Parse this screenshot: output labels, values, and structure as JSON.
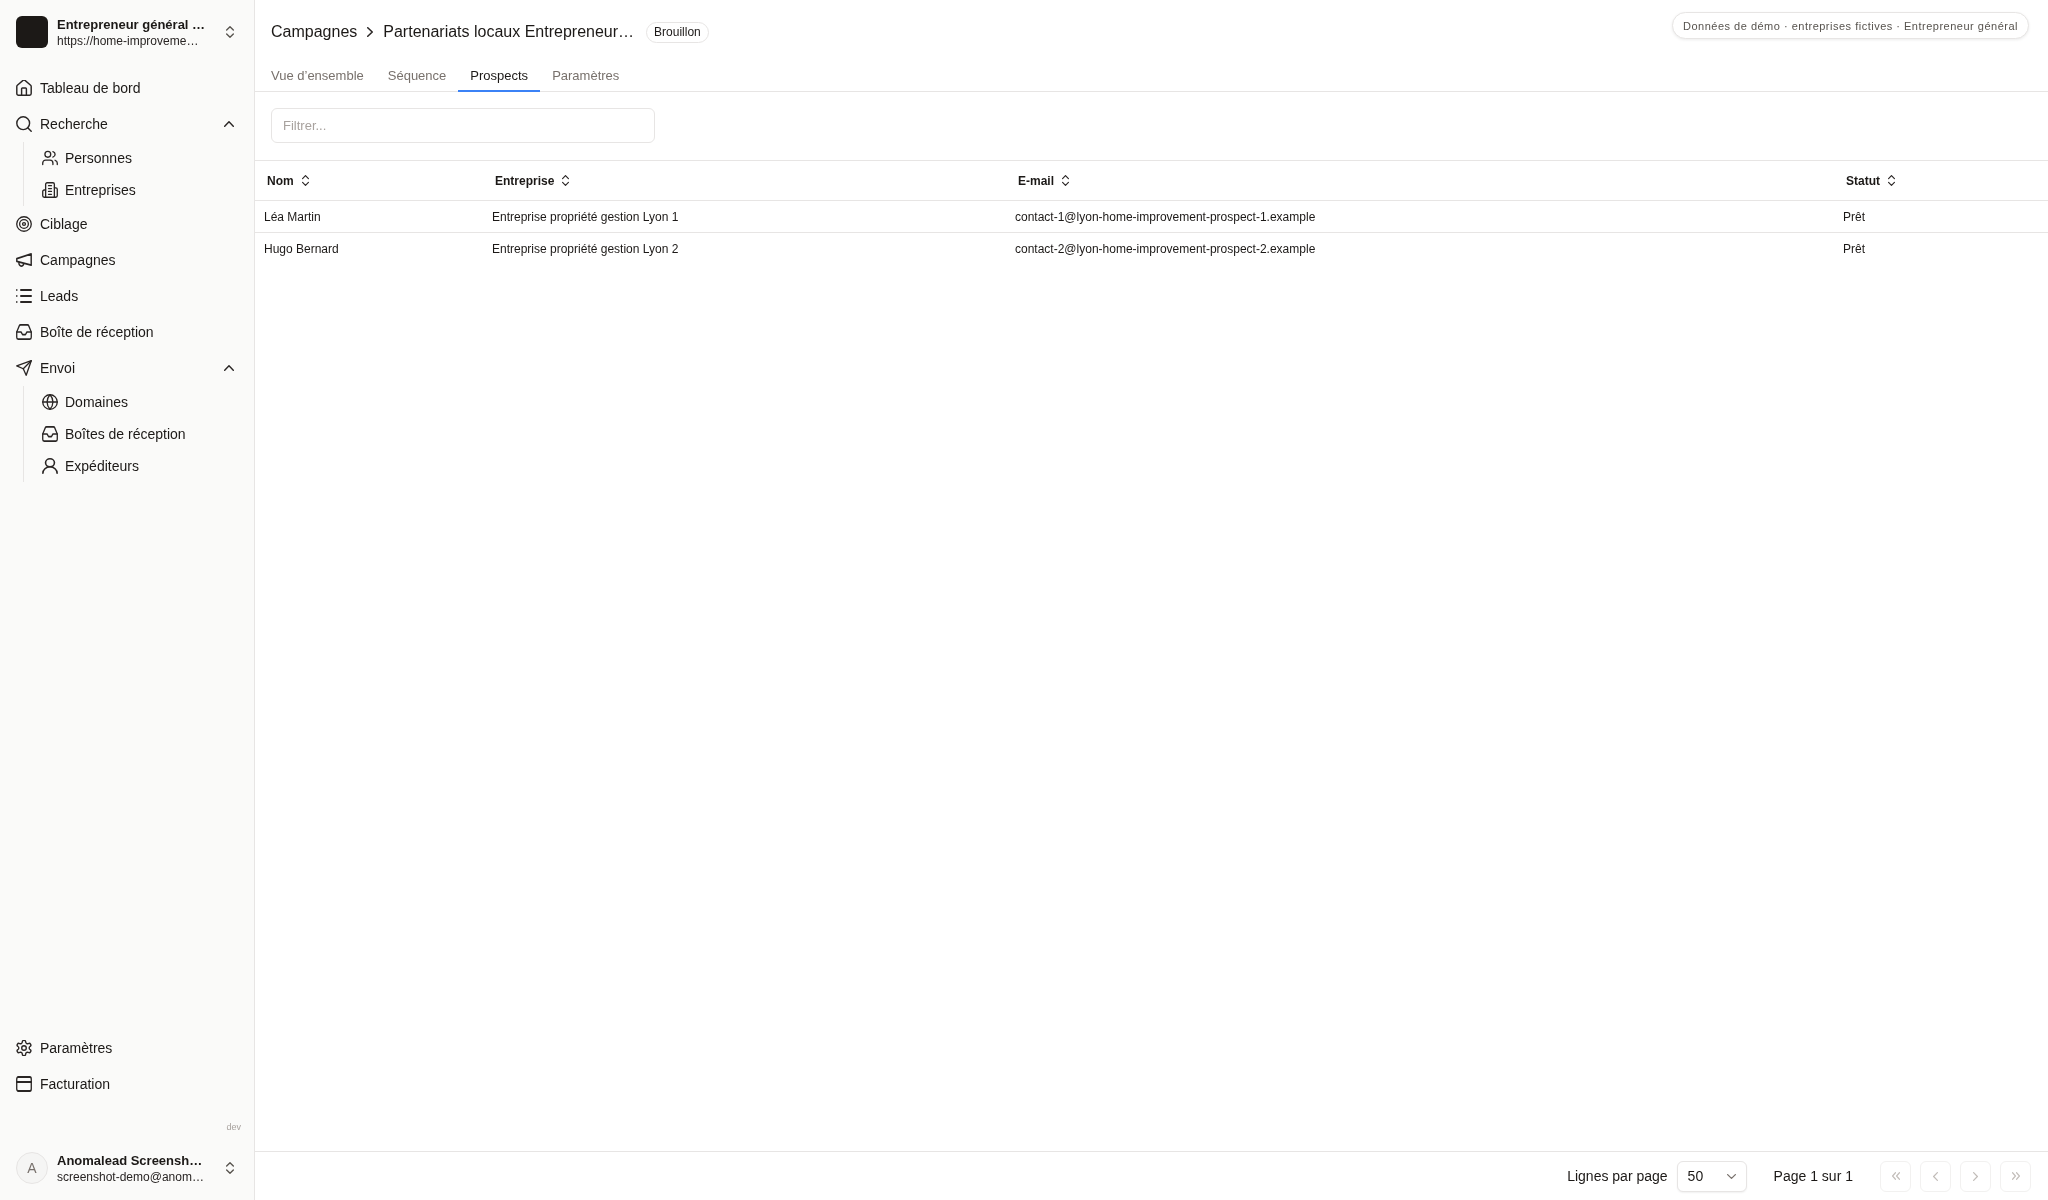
{
  "sidebar": {
    "workspace": {
      "name": "Entrepreneur général …",
      "url": "https://home-improveme…"
    },
    "nav": [
      {
        "label": "Tableau de bord"
      },
      {
        "label": "Recherche",
        "expanded": true,
        "children": [
          {
            "label": "Personnes"
          },
          {
            "label": "Entreprises"
          }
        ]
      },
      {
        "label": "Ciblage"
      },
      {
        "label": "Campagnes"
      },
      {
        "label": "Leads"
      },
      {
        "label": "Boîte de réception"
      },
      {
        "label": "Envoi",
        "expanded": true,
        "children": [
          {
            "label": "Domaines"
          },
          {
            "label": "Boîtes de réception"
          },
          {
            "label": "Expéditeurs"
          }
        ]
      }
    ],
    "footer_nav": [
      {
        "label": "Paramètres"
      },
      {
        "label": "Facturation"
      }
    ],
    "environment": "dev",
    "user": {
      "initial": "A",
      "name": "Anomalead Screensh…",
      "email": "screenshot-demo@anom…"
    }
  },
  "header": {
    "breadcrumb": [
      "Campagnes",
      "Partenariats locaux Entrepreneur…"
    ],
    "status_badge": "Brouillon",
    "demo_notice": "Données de démo · entreprises fictives · Entrepreneur général"
  },
  "tabs": [
    {
      "label": "Vue d’ensemble",
      "selected": false
    },
    {
      "label": "Séquence",
      "selected": false
    },
    {
      "label": "Prospects",
      "selected": true
    },
    {
      "label": "Paramètres",
      "selected": false
    }
  ],
  "filter": {
    "placeholder": "Filtrer..."
  },
  "table": {
    "columns": [
      "Nom",
      "Entreprise",
      "E-mail",
      "Statut"
    ],
    "rows": [
      {
        "cells": [
          "Léa Martin",
          "Entreprise propriété gestion Lyon 1",
          "contact-1@lyon-home-improvement-prospect-1.example",
          "Prêt"
        ]
      },
      {
        "cells": [
          "Hugo Bernard",
          "Entreprise propriété gestion Lyon 2",
          "contact-2@lyon-home-improvement-prospect-2.example",
          "Prêt"
        ]
      }
    ]
  },
  "pagination": {
    "rows_per_page_label": "Lignes par page",
    "rows_per_page": "50",
    "page_info": "Page 1 sur 1",
    "buttons": [
      {
        "kind": "first",
        "disabled": true
      },
      {
        "kind": "previous",
        "disabled": true
      },
      {
        "kind": "next",
        "disabled": true
      },
      {
        "kind": "last",
        "disabled": true
      }
    ]
  }
}
